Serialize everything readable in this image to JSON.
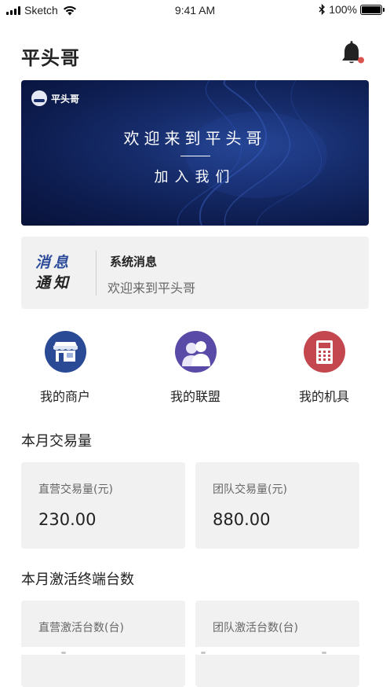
{
  "status_bar": {
    "carrier": "Sketch",
    "time": "9:41 AM",
    "battery": "100%",
    "icons": [
      "signal-icon",
      "wifi-icon",
      "bluetooth-icon",
      "battery-icon"
    ]
  },
  "header": {
    "title": "平头哥",
    "notification_icon": "bell-icon",
    "has_unread": true
  },
  "banner": {
    "logo_text": "平头哥",
    "title": "欢迎来到平头哥",
    "subtitle": "加入我们"
  },
  "notice": {
    "badge_line1": "消息",
    "badge_line2": "通知",
    "title": "系统消息",
    "text": "欢迎来到平头哥"
  },
  "quick_links": [
    {
      "label": "我的商户",
      "icon": "store-icon",
      "color": "#2b4a96"
    },
    {
      "label": "我的联盟",
      "icon": "people-icon",
      "color": "#5a4aa8"
    },
    {
      "label": "我的机具",
      "icon": "pos-machine-icon",
      "color": "#c4474f"
    }
  ],
  "transactions": {
    "title": "本月交易量",
    "direct_label": "直营交易量(元)",
    "direct_value": "230.00",
    "team_label": "团队交易量(元)",
    "team_value": "880.00"
  },
  "activations": {
    "title": "本月激活终端台数",
    "direct_label": "直营激活台数(台)",
    "team_label": "团队激活台数(台)"
  },
  "colors": {
    "accent_blue": "#2c4a9a",
    "card_bg": "#f1f1f1",
    "badge_red": "#d9534f"
  }
}
